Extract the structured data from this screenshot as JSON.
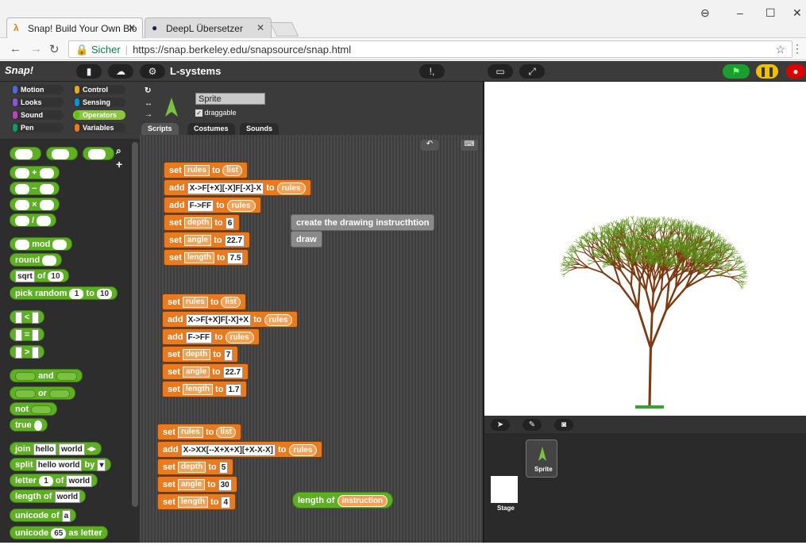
{
  "browser": {
    "tabs": [
      {
        "label": "Snap! Build Your Own Blo",
        "icon": "lambda-icon",
        "active": true
      },
      {
        "label": "DeepL Übersetzer",
        "icon": "deepl-icon",
        "active": false
      }
    ],
    "address": {
      "secure_label": "Sicher",
      "url": "https://snap.berkeley.edu/snapsource/snap.html"
    }
  },
  "snap": {
    "logo": "Snap!",
    "project_title": "L-systems",
    "categories": [
      "Motion",
      "Control",
      "Looks",
      "Sensing",
      "Sound",
      "Operators",
      "Pen",
      "Variables"
    ],
    "palette_blocks": {
      "plus": "+",
      "minus": "−",
      "times": "×",
      "divide": "/",
      "mod": "mod",
      "round": "round",
      "sqrt_op": "sqrt",
      "of": "of",
      "sqrt_val": "10",
      "pick_random": "pick random",
      "pick_from": "1",
      "to": "to",
      "pick_to": "10",
      "lt": "<",
      "eq": "=",
      "gt": ">",
      "and": "and",
      "or": "or",
      "not": "not",
      "true": "true",
      "join": "join",
      "join_a": "hello",
      "join_b": "world",
      "split": "split",
      "split_a": "hello world",
      "by": "by",
      "letter": "letter",
      "letter_n": "1",
      "letter_of": "of",
      "letter_w": "world",
      "length_of": "length of",
      "length_w": "world",
      "unicode_of": "unicode of",
      "unicode_a": "a",
      "unicode": "unicode",
      "unicode_n": "65",
      "as_letter": "as letter"
    },
    "sprite": {
      "name": "Sprite",
      "draggable_label": "draggable"
    },
    "tabs": [
      "Scripts",
      "Costumes",
      "Sounds"
    ],
    "scripts": {
      "set": "set",
      "to": "to",
      "add": "add",
      "list": "list",
      "rules": "rules",
      "depth": "depth",
      "angle": "angle",
      "length": "length",
      "group1": {
        "rule1": "X->F[+X][-X]F[-X]-X",
        "rule2": "F->FF",
        "depth": "6",
        "angle": "22.7",
        "length": "7.5"
      },
      "group2": {
        "rule1": "X->F[+X]F[-X]+X",
        "rule2": "F->FF",
        "depth": "7",
        "angle": "22.7",
        "length": "1.7"
      },
      "group3": {
        "rule1": "X->XX[--X+X+X][+X-X-X]",
        "depth": "5",
        "angle": "30",
        "length": "4"
      },
      "custom1": "create the drawing instructhtion",
      "custom2": "draw",
      "length_of": "length of",
      "instruction": "instruction"
    },
    "corral": {
      "sprite_label": "Sprite",
      "stage_label": "Stage"
    }
  },
  "colors": {
    "motion": "#4a6cd4",
    "looks": "#8a55d7",
    "sound": "#bb42c3",
    "pen": "#0e9a6c",
    "control": "#e6a822",
    "sensing": "#0494dc",
    "operators": "#62c213",
    "variables": "#f3761d"
  }
}
